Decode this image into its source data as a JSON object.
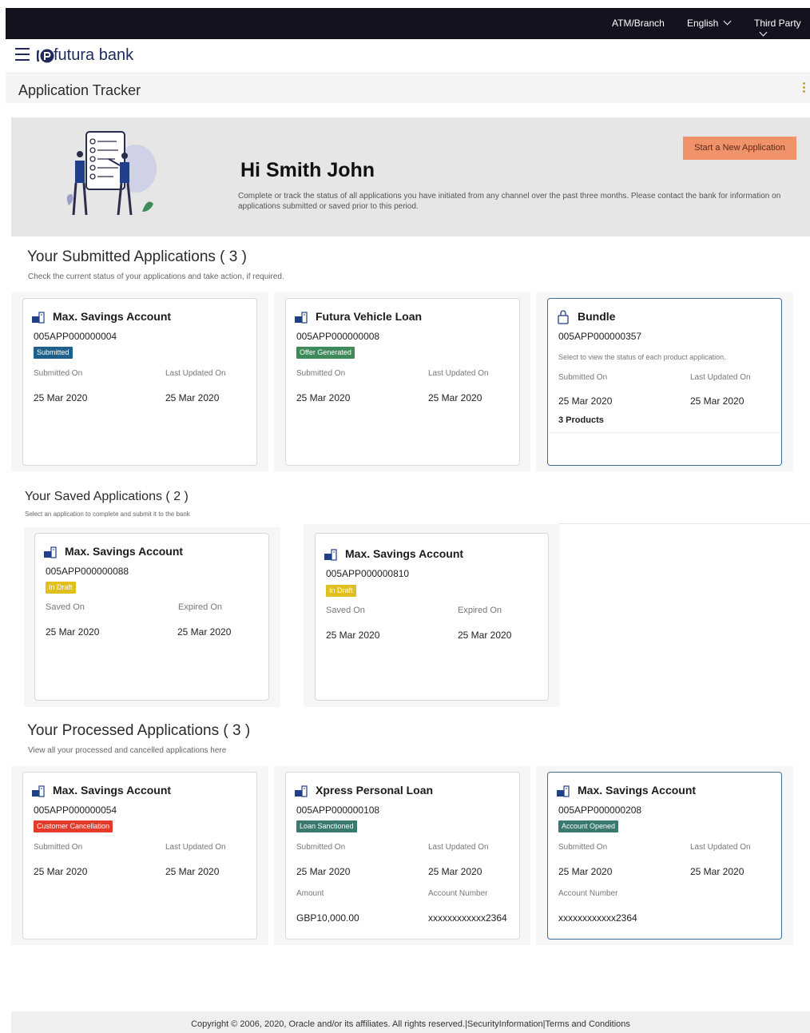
{
  "topbar": {
    "atm_branch": "ATM/Branch",
    "language": "English",
    "third_party": "Third Party"
  },
  "brand": {
    "name": "futura bank"
  },
  "page": {
    "title": "Application Tracker"
  },
  "hero": {
    "greeting": "Hi Smith John",
    "description": "Complete or track the status of all applications you have initiated from any channel over the past three months. Please contact the bank for information on applications submitted or saved prior to this period.",
    "start_button": "Start a New Application"
  },
  "submitted": {
    "title": "Your Submitted Applications ( 3 )",
    "subtitle": "Check the current status of your applications and take action, if required.",
    "cards": [
      {
        "name": "Max. Savings Account",
        "id": "005APP000000004",
        "badge": "Submitted",
        "label1": "Submitted On",
        "label2": "Last Updated On",
        "value1": "25 Mar 2020",
        "value2": "25 Mar 2020"
      },
      {
        "name": "Futura Vehicle Loan",
        "id": "005APP000000008",
        "badge": "Offer Generated",
        "label1": "Submitted On",
        "label2": "Last Updated On",
        "value1": "25 Mar 2020",
        "value2": "25 Mar 2020"
      },
      {
        "name": "Bundle",
        "id": "005APP000000357",
        "note": "Select to view the status of each product application.",
        "label1": "Submitted On",
        "label2": "Last Updated On",
        "value1": "25 Mar 2020",
        "value2": "25 Mar 2020",
        "products": "3 Products"
      }
    ]
  },
  "saved": {
    "title": "Your Saved Applications  ( 2 )",
    "subtitle": "Select an application to complete and submit it to the bank",
    "cards": [
      {
        "name": "Max. Savings Account",
        "id": "005APP000000088",
        "badge": "In Draft",
        "label1": "Saved On",
        "label2": "Expired On",
        "value1": "25 Mar 2020",
        "value2": "25 Mar 2020"
      },
      {
        "name": "Max. Savings Account",
        "id": "005APP000000810",
        "badge": "In Draft",
        "label1": "Saved On",
        "label2": "Expired On",
        "value1": "25 Mar 2020",
        "value2": "25 Mar 2020"
      }
    ]
  },
  "processed": {
    "title": "Your Processed Applications ( 3 )",
    "subtitle": "View all your processed and cancelled applications here",
    "cards": [
      {
        "name": "Max. Savings Account",
        "id": "005APP000000054",
        "badge": "Customer Cancellation",
        "label1": "Submitted On",
        "label2": "Last Updated On",
        "value1": "25 Mar 2020",
        "value2": "25 Mar 2020"
      },
      {
        "name": "Xpress Personal Loan",
        "id": "005APP000000108",
        "badge": "Loan Sanctioned",
        "label1": "Submitted On",
        "label2": "Last Updated On",
        "value1": "25 Mar 2020",
        "value2": "25 Mar 2020",
        "label3": "Amount",
        "label4": "Account Number",
        "value3": "GBP10,000.00",
        "value4": "xxxxxxxxxxxx2364"
      },
      {
        "name": "Max. Savings Account",
        "id": "005APP000000208",
        "badge": "Account Opened",
        "label1": "Submitted On",
        "label2": "Last Updated On",
        "value1": "25 Mar 2020",
        "value2": "25 Mar 2020",
        "label3": "Account Number",
        "value3": "xxxxxxxxxxxx2364"
      }
    ]
  },
  "footer": {
    "copyright": "Copyright © 2006, 2020, Oracle and/or its affiliates. All rights reserved.",
    "separator": "|",
    "security": "SecurityInformation",
    "terms": "Terms and Conditions"
  },
  "colors": {
    "topbar": "#12131f",
    "brand": "#1f2a5c",
    "accent_button": "#f0926a",
    "badge_submitted": "#1f5f8b",
    "badge_offer": "#3e8a5a",
    "badge_draft": "#e0bf1e",
    "badge_cancel": "#e33a2a",
    "selected_border": "#3e6da0"
  },
  "icons": {
    "menu": "hamburger-icon",
    "language_dropdown": "chevron-down-icon",
    "card_product": "account-product-icon",
    "bundle": "bundle-lock-icon",
    "more": "kebab-menu-icon"
  }
}
